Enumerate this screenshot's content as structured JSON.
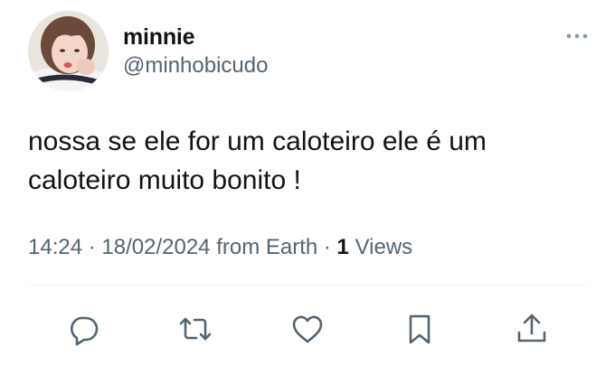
{
  "user": {
    "display_name": "minnie",
    "handle": "@minhobicudo"
  },
  "tweet": {
    "text": "nossa se ele for um caloteiro ele é um caloteiro muito bonito !",
    "time": "14:24",
    "separator": " · ",
    "date": "18/02/2024",
    "source": "from Earth",
    "views_count": "1",
    "views_label": "Views"
  },
  "icons": {
    "more": "more-horizontal-icon",
    "reply": "reply-icon",
    "retweet": "retweet-icon",
    "like": "like-icon",
    "bookmark": "bookmark-icon",
    "share": "share-icon"
  },
  "colors": {
    "text_primary": "#0f1419",
    "text_secondary": "#536471",
    "divider": "#eff3f4",
    "icon": "#536471"
  }
}
